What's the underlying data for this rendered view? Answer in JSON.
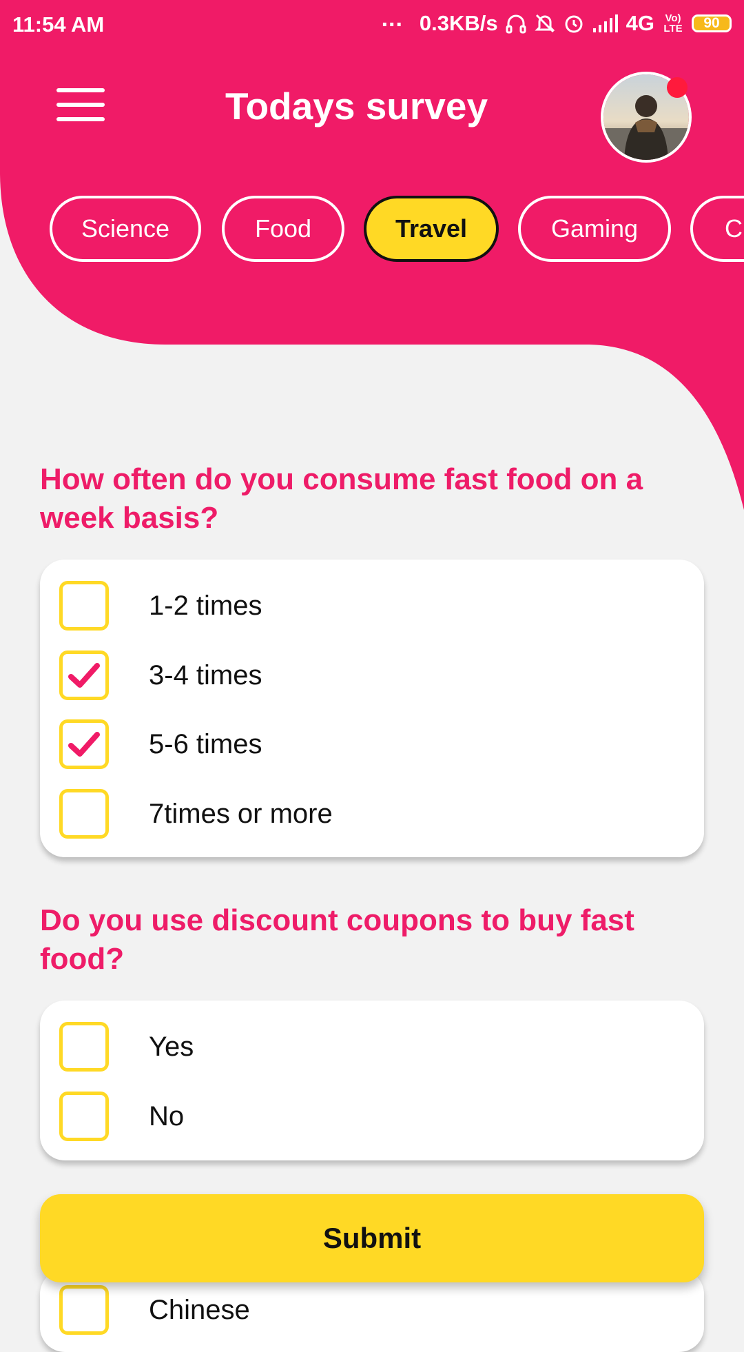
{
  "status_bar": {
    "time": "11:54 AM",
    "dots": "...",
    "network_speed": "0.3KB/s",
    "network_type": "4G",
    "volte": "Vo) LTE",
    "battery": "90"
  },
  "header": {
    "title": "Todays survey",
    "menu_icon": "hamburger-menu-icon",
    "avatar": "user-avatar",
    "accent_color": "#f01b67",
    "highlight_color": "#ffd925"
  },
  "tabs": [
    {
      "label": "Science",
      "active": false
    },
    {
      "label": "Food",
      "active": false
    },
    {
      "label": "Travel",
      "active": true
    },
    {
      "label": "Gaming",
      "active": false
    },
    {
      "label": "Cu",
      "active": false
    }
  ],
  "questions": [
    {
      "text": "How often do you consume fast food on a week basis?",
      "options": [
        {
          "label": "1-2 times",
          "checked": false
        },
        {
          "label": "3-4 times",
          "checked": true
        },
        {
          "label": "5-6 times",
          "checked": true
        },
        {
          "label": "7times or more",
          "checked": false
        }
      ]
    },
    {
      "text": "Do you use discount coupons to buy fast food?",
      "options": [
        {
          "label": "Yes",
          "checked": false
        },
        {
          "label": "No",
          "checked": false
        }
      ]
    }
  ],
  "submit_label": "Submit",
  "partial_option": {
    "label": "Chinese",
    "checked": false
  }
}
